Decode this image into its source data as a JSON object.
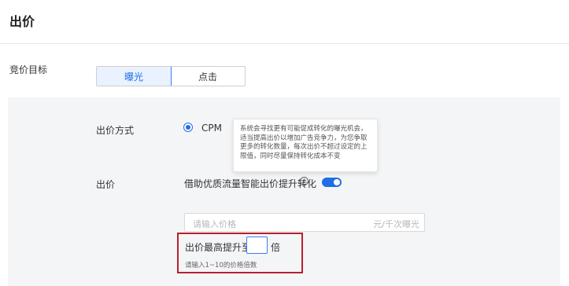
{
  "header": {
    "title": "出价"
  },
  "objective": {
    "label": "竞价目标",
    "options": [
      {
        "label": "曝光",
        "active": true
      },
      {
        "label": "点击",
        "active": false
      }
    ]
  },
  "bidding": {
    "method_label": "出价方式",
    "method_value": "CPM",
    "tooltip": "系统会寻找更有可能促成转化的曝光机会，适当提高出价以增加广告竞争力，为您争取更多的转化数量，每次出价不超过设定的上限值，同时尽量保持转化成本不变",
    "bid_label": "出价",
    "smart_bid_label": "借助优质流量智能出价提升转化",
    "price_placeholder": "请输入价格",
    "price_unit": "元/千次曝光",
    "max_raise_label": "出价最高提升至",
    "max_raise_unit": "倍",
    "max_raise_hint": "请输入1~10的价格倍数"
  },
  "colors": {
    "accent": "#1f6fe5",
    "highlight_box": "#b7202e",
    "panel_bg": "#f4f5f7"
  }
}
